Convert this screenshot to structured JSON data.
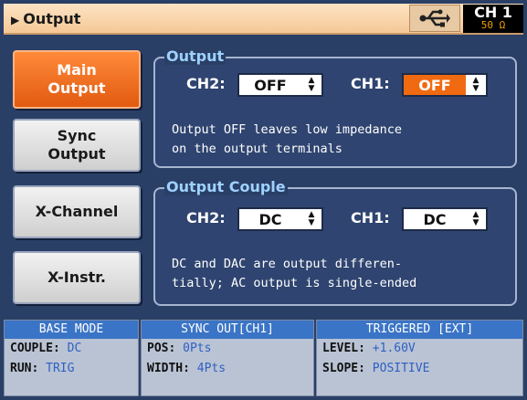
{
  "header": {
    "title": "Output",
    "channel": "CH 1",
    "impedance": "50 Ω"
  },
  "sidebar": {
    "items": [
      {
        "label": "Main\nOutput",
        "active": true
      },
      {
        "label": "Sync\nOutput",
        "active": false
      },
      {
        "label": "X-Channel",
        "active": false
      },
      {
        "label": "X-Instr.",
        "active": false
      }
    ]
  },
  "output_panel": {
    "legend": "Output",
    "ch2_label": "CH2:",
    "ch2_value": "OFF",
    "ch1_label": "CH1:",
    "ch1_value": "OFF",
    "note": "Output OFF leaves low impedance\non the output terminals"
  },
  "couple_panel": {
    "legend": "Output Couple",
    "ch2_label": "CH2:",
    "ch2_value": "DC",
    "ch1_label": "CH1:",
    "ch1_value": "DC",
    "note": "DC and DAC are output differen-\ntially; AC output is single-ended"
  },
  "status": {
    "base": {
      "header": "BASE MODE",
      "couple_key": "COUPLE:",
      "couple_val": "DC",
      "run_key": "RUN:",
      "run_val": "TRIG"
    },
    "sync": {
      "header": "SYNC OUT[CH1]",
      "pos_key": "POS:",
      "pos_val": "0Pts",
      "width_key": "WIDTH:",
      "width_val": "4Pts"
    },
    "trig": {
      "header": "TRIGGERED [EXT]",
      "level_key": "LEVEL:",
      "level_val": "+1.60V",
      "slope_key": "SLOPE:",
      "slope_val": "POSITIVE"
    }
  },
  "colors": {
    "accent": "#f06a12",
    "panel_title": "#9fd2ff",
    "status_header": "#3a74c6"
  }
}
